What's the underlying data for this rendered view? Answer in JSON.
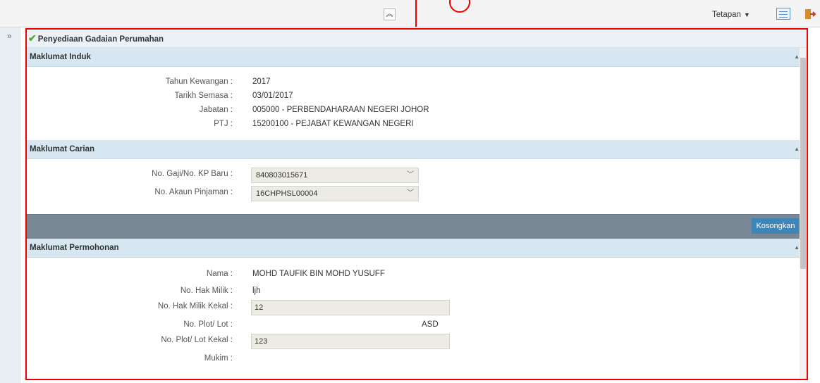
{
  "topbar": {
    "settings_label": "Tetapan",
    "settings_caret": "▼",
    "collapse_glyph": "≈"
  },
  "page": {
    "title": "Penyediaan Gadaian Perumahan"
  },
  "sections": {
    "induk": {
      "title": "Maklumat Induk",
      "fields": [
        {
          "label": "Tahun Kewangan :",
          "value": "2017"
        },
        {
          "label": "Tarikh Semasa :",
          "value": "03/01/2017"
        },
        {
          "label": "Jabatan :",
          "value": "005000 - PERBENDAHARAAN NEGERI JOHOR"
        },
        {
          "label": "PTJ :",
          "value": "15200100 - PEJABAT KEWANGAN NEGERI"
        }
      ]
    },
    "carian": {
      "title": "Maklumat Carian",
      "fields": [
        {
          "label": "No. Gaji/No. KP Baru :",
          "value": "840803015671"
        },
        {
          "label": "No. Akaun Pinjaman :",
          "value": "16CHPHSL00004"
        }
      ],
      "clear_button": "Kosongkan"
    },
    "permohonan": {
      "title": "Maklumat Permohonan",
      "fields": [
        {
          "label": "Nama :",
          "value": "MOHD TAUFIK BIN MOHD YUSUFF"
        },
        {
          "label": "No. Hak Milik :",
          "value": "ljh"
        },
        {
          "label": "No. Hak Milik Kekal :",
          "value": "12"
        },
        {
          "label": "No. Plot/ Lot :",
          "value": "ASD"
        },
        {
          "label": "No. Plot/ Lot Kekal :",
          "value": "123"
        },
        {
          "label": "Mukim :",
          "value": ""
        }
      ]
    }
  }
}
